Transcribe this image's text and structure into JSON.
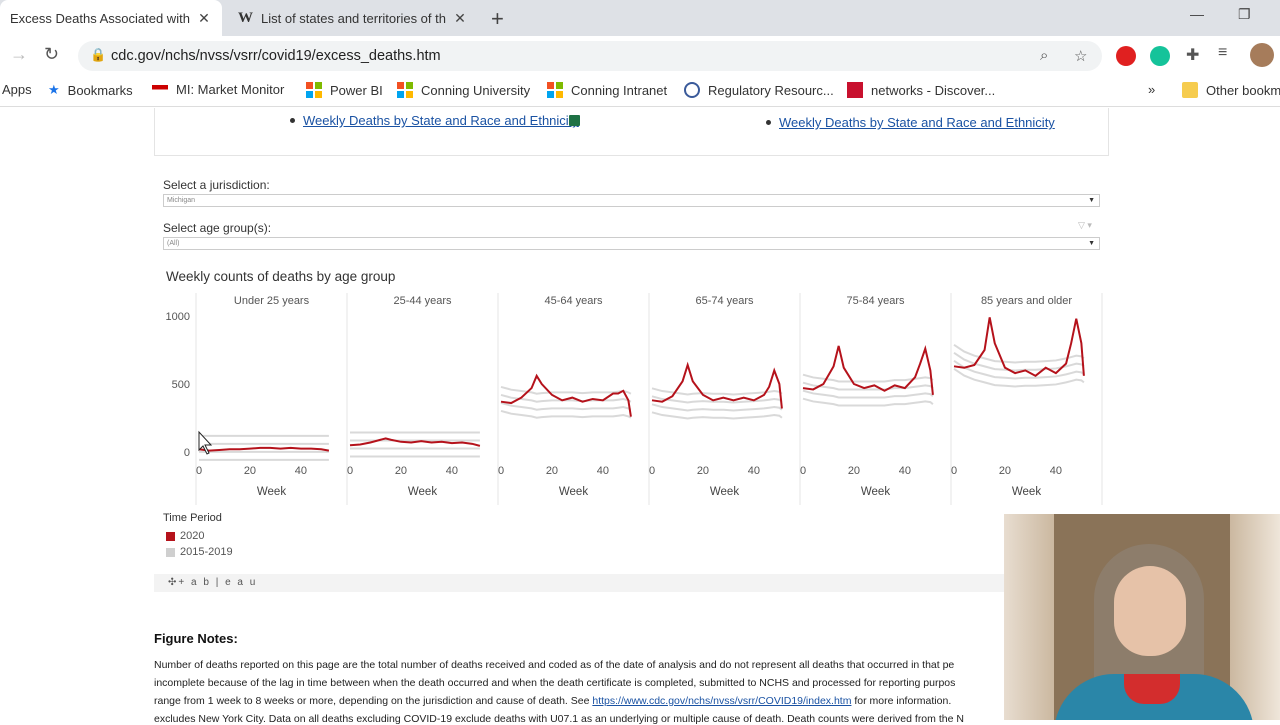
{
  "tabs": [
    {
      "title": "Excess Deaths Associated with C",
      "icon": "cdc-favicon",
      "active": true
    },
    {
      "title": "List of states and territories of th",
      "icon": "wikipedia-favicon",
      "active": false
    }
  ],
  "address_bar": {
    "url": "cdc.gov/nchs/nvss/vsrr/covid19/excess_deaths.htm"
  },
  "bookmarks": {
    "items": [
      "Apps",
      "Bookmarks",
      "MI: Market Monitor",
      "Power BI",
      "Conning University",
      "Conning Intranet",
      "Regulatory Resourc...",
      "networks - Discover..."
    ],
    "more": "»",
    "other": "Other bookm"
  },
  "links": {
    "left": "Weekly Deaths by State and Race and Ethnicity",
    "right": "Weekly Deaths by State and Race and Ethnicity"
  },
  "filters": {
    "jurisdiction_label": "Select a jurisdiction:",
    "jurisdiction_value": "Michigan",
    "age_label": "Select age group(s):",
    "age_value": "(All)"
  },
  "chart_data": {
    "type": "line",
    "title": "Weekly counts of deaths by age group",
    "xlabel": "Week",
    "x_ticks": [
      "0",
      "20",
      "40"
    ],
    "y_ticks": [
      "0",
      "500",
      "1000"
    ],
    "ylim": [
      0,
      1000
    ],
    "xlim": [
      0,
      53
    ],
    "legend_title": "Time Period",
    "legend": [
      {
        "name": "2020",
        "color": "#b5121b"
      },
      {
        "name": "2015-2019",
        "color": "#cfcfcf"
      }
    ],
    "panels": [
      {
        "name": "Under 25 years",
        "weeks_2020": [
          0,
          4,
          8,
          12,
          16,
          20,
          24,
          28,
          32,
          36,
          40,
          44,
          48,
          51
        ],
        "values_2020": [
          20,
          10,
          15,
          20,
          20,
          25,
          30,
          30,
          25,
          30,
          25,
          25,
          20,
          10
        ],
        "baseline": [
          30,
          30,
          30,
          30,
          30,
          30,
          30,
          30,
          30,
          30,
          30,
          30,
          30,
          30
        ]
      },
      {
        "name": "25-44 years",
        "weeks_2020": [
          0,
          4,
          8,
          12,
          14,
          16,
          20,
          24,
          28,
          32,
          36,
          40,
          44,
          48,
          51
        ],
        "values_2020": [
          50,
          55,
          70,
          90,
          100,
          90,
          75,
          70,
          80,
          70,
          75,
          65,
          70,
          60,
          45
        ],
        "baseline": [
          55,
          55,
          55,
          55,
          55,
          55,
          55,
          55,
          55,
          55,
          55,
          55,
          55,
          55,
          55
        ]
      },
      {
        "name": "45-64 years",
        "weeks_2020": [
          0,
          4,
          8,
          12,
          14,
          16,
          20,
          24,
          28,
          32,
          36,
          40,
          44,
          46,
          48,
          50,
          51
        ],
        "values_2020": [
          370,
          360,
          400,
          470,
          560,
          500,
          420,
          380,
          400,
          370,
          390,
          380,
          430,
          430,
          450,
          380,
          260
        ],
        "baseline": [
          390,
          370,
          360,
          350,
          340,
          345,
          350,
          350,
          350,
          345,
          350,
          350,
          350,
          355,
          360,
          350,
          340
        ]
      },
      {
        "name": "65-74 years",
        "weeks_2020": [
          0,
          4,
          8,
          12,
          14,
          16,
          20,
          24,
          28,
          32,
          36,
          40,
          44,
          46,
          48,
          50,
          51
        ],
        "values_2020": [
          380,
          370,
          410,
          520,
          640,
          520,
          420,
          380,
          400,
          380,
          400,
          380,
          420,
          480,
          600,
          500,
          320
        ],
        "baseline": [
          380,
          360,
          350,
          340,
          335,
          340,
          345,
          340,
          340,
          335,
          340,
          345,
          350,
          355,
          360,
          355,
          340
        ]
      },
      {
        "name": "75-84 years",
        "weeks_2020": [
          0,
          4,
          8,
          12,
          14,
          16,
          20,
          24,
          28,
          32,
          36,
          40,
          44,
          46,
          48,
          50,
          51
        ],
        "values_2020": [
          470,
          460,
          500,
          630,
          780,
          620,
          500,
          470,
          490,
          450,
          490,
          470,
          550,
          650,
          760,
          600,
          420
        ],
        "baseline": [
          480,
          460,
          450,
          440,
          430,
          430,
          430,
          430,
          430,
          430,
          440,
          440,
          450,
          455,
          460,
          455,
          440
        ]
      },
      {
        "name": "85 years and older",
        "weeks_2020": [
          0,
          4,
          8,
          12,
          14,
          16,
          20,
          24,
          28,
          32,
          36,
          40,
          44,
          46,
          48,
          50,
          51
        ],
        "values_2020": [
          630,
          620,
          640,
          750,
          990,
          800,
          620,
          580,
          600,
          560,
          620,
          580,
          650,
          800,
          980,
          800,
          560
        ],
        "baseline": [
          700,
          650,
          620,
          600,
          590,
          580,
          575,
          570,
          575,
          575,
          580,
          585,
          600,
          610,
          620,
          615,
          600
        ]
      }
    ]
  },
  "branding": {
    "tableau": "+ a b | e a u"
  },
  "figure_notes": {
    "heading": "Figure Notes:",
    "line1": "Number of deaths reported on this page are the total number of deaths received and coded as of the date of analysis and do not represent all deaths that occurred in that pe",
    "line2": "incomplete because of the lag in time between when the death occurred and when the death certificate is completed, submitted to NCHS and processed for reporting purpos",
    "line3_a": "range from 1 week to 8 weeks or more, depending on the jurisdiction and cause of death. See ",
    "line3_link": "https://www.cdc.gov/nchs/nvss/vsrr/COVID19/index.htm",
    "line3_b": " for more information.",
    "line4": "excludes New York City. Data on all deaths excluding COVID-19 exclude deaths with U07.1 as an underlying or multiple cause of death. Death counts were derived from the N"
  },
  "colors": {
    "accent": "#b5121b",
    "baseline": "#cfcfcf",
    "link": "#1a52a3"
  }
}
